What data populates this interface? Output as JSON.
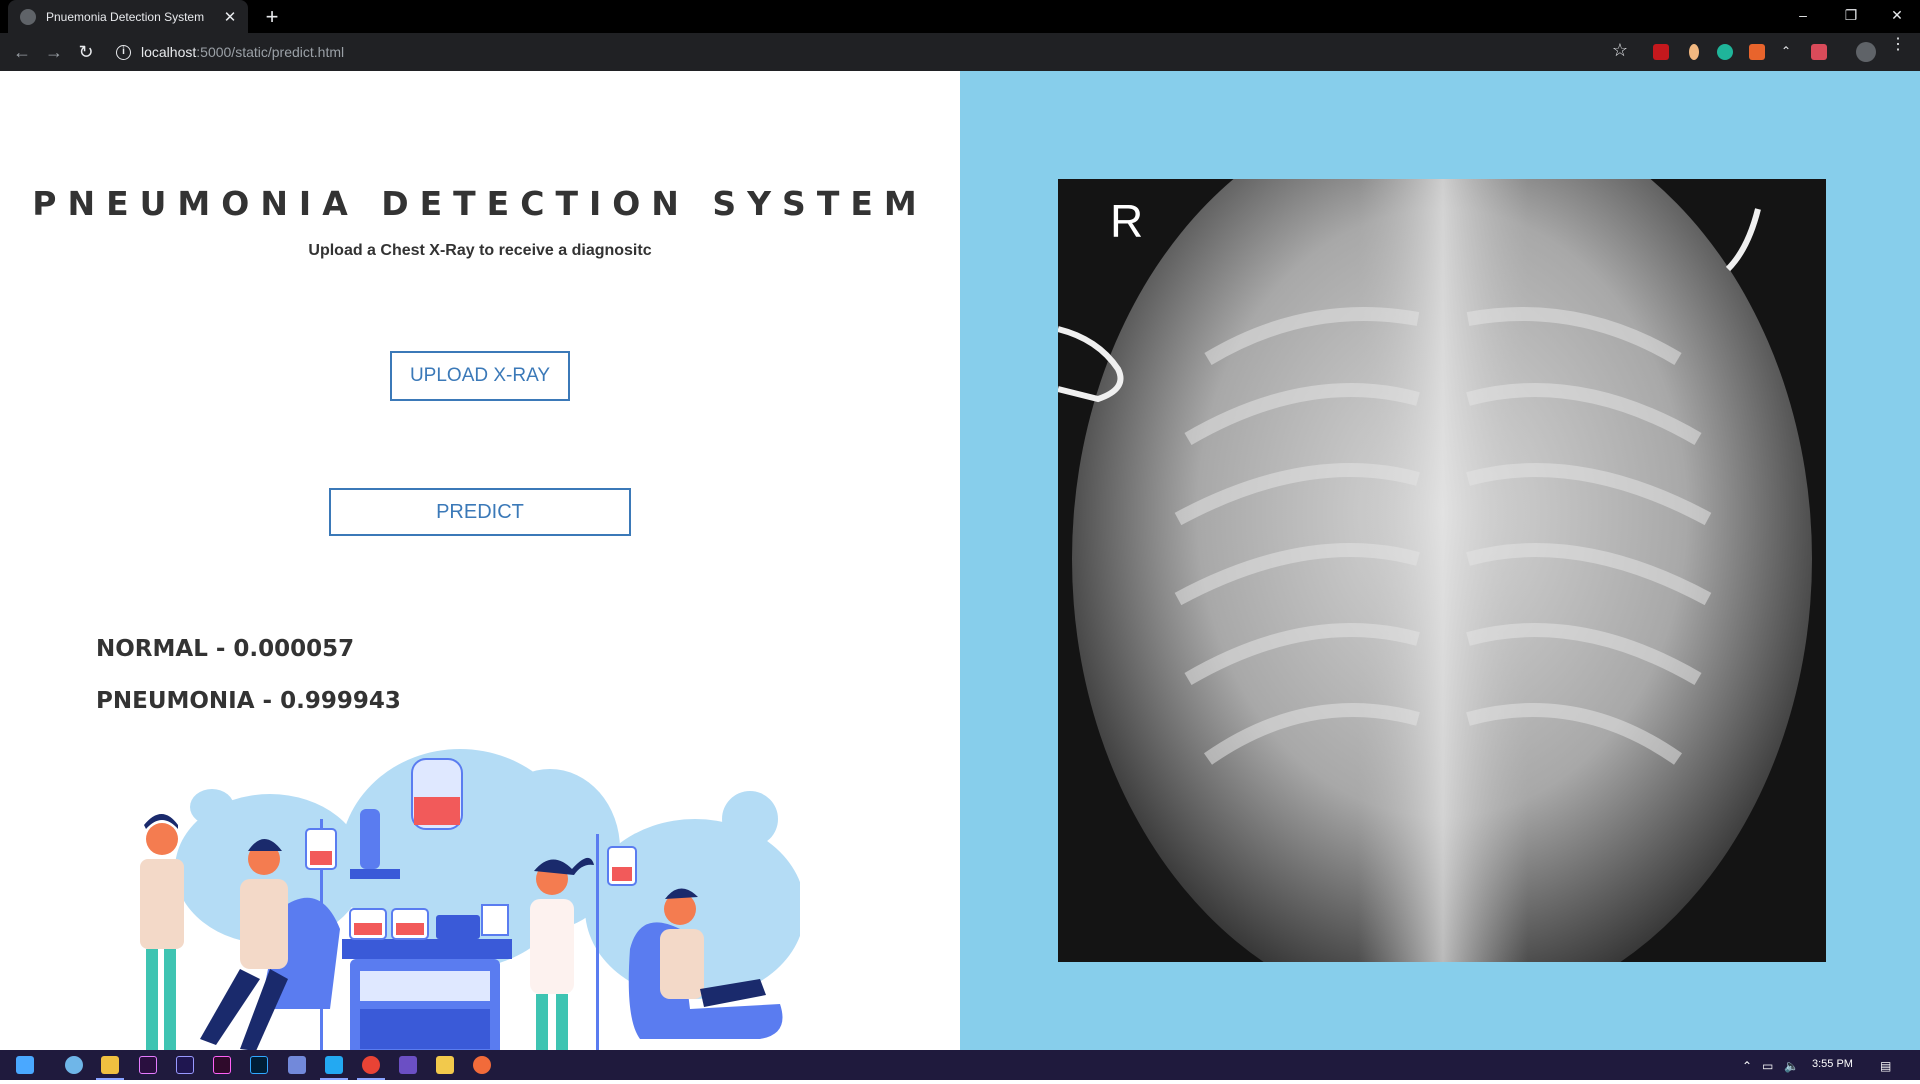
{
  "browser": {
    "tab_title": "Pnuemonia Detection System",
    "tab_close": "✕",
    "new_tab": "+",
    "url_host": "localhost",
    "url_rest": ":5000/static/predict.html",
    "minimize": "–",
    "restore": "❐",
    "close": "✕"
  },
  "page": {
    "title": "PNEUMONIA DETECTION SYSTEM",
    "subtitle": "Upload a Chest X-Ray to receive a diagnositc",
    "upload_label": "UPLOAD X-RAY",
    "predict_label": "PREDICT",
    "results": {
      "normal": "NORMAL - 0.000057",
      "pneumonia": "PNEUMONIA - 0.999943"
    },
    "xray_marker": "R"
  },
  "colors": {
    "right_panel": "#87ceeb",
    "accent": "#3b79b8",
    "text": "#333333"
  },
  "taskbar": {
    "time": "3:55 PM"
  }
}
